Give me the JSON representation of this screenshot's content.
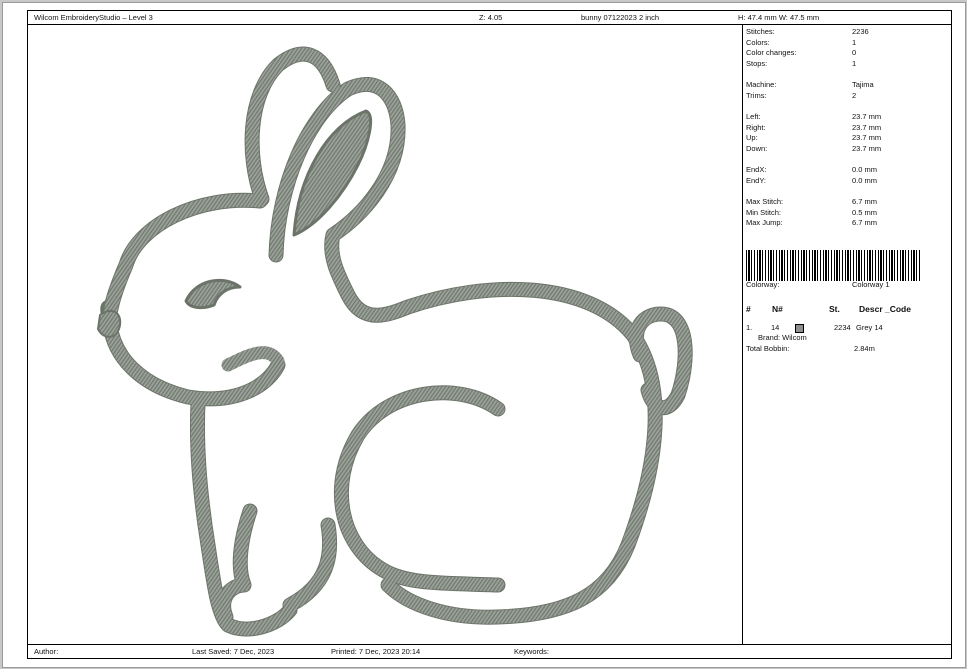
{
  "header": {
    "app_title": "Wilcom EmbroideryStudio – Level 3",
    "zoom": "Z: 4.05",
    "design_name": "bunny 07122023 2 inch",
    "dimensions": "H: 47.4 mm   W: 47.5 mm"
  },
  "footer": {
    "author_label": "Author:",
    "last_saved": "Last Saved:  7 Dec, 2023",
    "printed": "Printed:  7 Dec, 2023 20:14",
    "keywords_label": "Keywords:"
  },
  "stats": [
    {
      "label": "Stitches:",
      "value": "2236"
    },
    {
      "label": "Colors:",
      "value": "1"
    },
    {
      "label": "Color changes:",
      "value": "0"
    },
    {
      "label": "Stops:",
      "value": "1"
    },
    {
      "label": "Machine:",
      "value": "Tajima"
    },
    {
      "label": "Trims:",
      "value": "2"
    },
    {
      "label": "Left:",
      "value": "23.7 mm"
    },
    {
      "label": "Right:",
      "value": "23.7 mm"
    },
    {
      "label": "Up:",
      "value": "23.7 mm"
    },
    {
      "label": "Down:",
      "value": "23.7 mm"
    },
    {
      "label": "EndX:",
      "value": "0.0 mm"
    },
    {
      "label": "EndY:",
      "value": "0.0 mm"
    },
    {
      "label": "Max Stitch:",
      "value": "6.7 mm"
    },
    {
      "label": "Min Stitch:",
      "value": "0.5 mm"
    },
    {
      "label": "Max Jump:",
      "value": "6.7 mm"
    }
  ],
  "colorway": {
    "label": "Colorway:",
    "value": "Colorway 1"
  },
  "color_table": {
    "headers": [
      "#",
      "N#",
      "St.",
      "Descr _Code"
    ],
    "rows": [
      {
        "index": "1.",
        "n": "14",
        "stitches": "2234",
        "descr": "Grey 14",
        "brand": "Brand: Wilcom",
        "color": "#8c928b"
      }
    ],
    "total_bobbin_label": "Total Bobbin:",
    "total_bobbin_value": "2.84m"
  },
  "thread_color": "#9ba39a"
}
